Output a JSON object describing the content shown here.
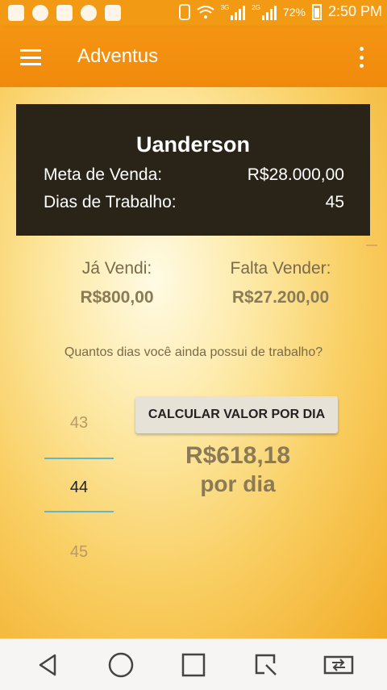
{
  "status_bar": {
    "battery": "72%",
    "time": "2:50 PM",
    "net_a": "3G",
    "net_b": "2G"
  },
  "app_bar": {
    "title": "Adventus"
  },
  "card": {
    "name": "Uanderson",
    "meta_label": "Meta de Venda:",
    "meta_value": "R$28.000,00",
    "dias_label": "Dias de Trabalho:",
    "dias_value": "45"
  },
  "summary": {
    "sold_label": "Já Vendi:",
    "sold_value": "R$800,00",
    "left_label": "Falta Vender:",
    "left_value": "R$27.200,00"
  },
  "question": "Quantos dias você ainda possui de trabalho?",
  "picker": {
    "prev": "43",
    "current": "44",
    "next": "45"
  },
  "button": {
    "label": "CALCULAR VALOR POR DIA"
  },
  "result": {
    "value": "R$618,18",
    "unit": "por dia"
  },
  "colors": {
    "accent": "#f39a14",
    "card": "#2a2418",
    "picker_line": "#5fb7c9"
  }
}
